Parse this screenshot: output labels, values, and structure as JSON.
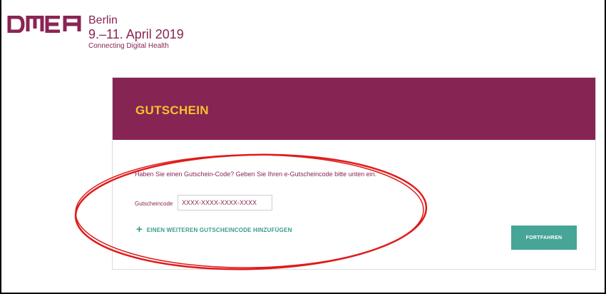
{
  "brand": {
    "logo_text": "DMEA",
    "city": "Berlin",
    "date": "9.–11. April 2019",
    "tagline": "Connecting Digital Health",
    "color": "#8a2454"
  },
  "voucher": {
    "title": "GUTSCHEIN",
    "intro": "Haben Sie einen Gutschein-Code? Geben Sie Ihren e-Gutscheincode bitte unten ein.",
    "code_label": "Gutscheincode",
    "code_placeholder": "XXXX-XXXX-XXXX-XXXX",
    "add_link": "EINEN WEITEREN GUTSCHEINCODE HINZUFÜGEN",
    "submit": "FORTFAHREN"
  },
  "colors": {
    "header_bg": "#862454",
    "title": "#f4c22b",
    "accent": "#46a597",
    "annotation": "#e01b1b"
  }
}
